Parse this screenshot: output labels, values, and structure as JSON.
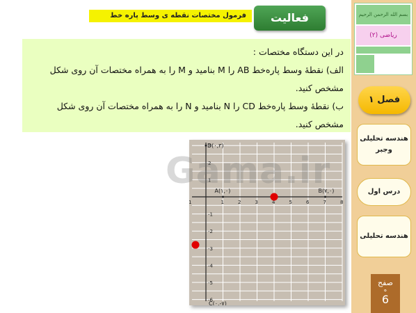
{
  "header": {
    "title": "فرمول مختصات نقطه ی وسط پاره خط",
    "activity_label": "فعالیت"
  },
  "problem": {
    "intro": "در این دستگاه مختصات :",
    "part_a": "الف) نقطهٔ وسط پاره‌خط AB را M بنامید و M را به همراه مختصات آن روی شکل مشخص کنید.",
    "part_b": "ب) نقطهٔ وسط پاره‌خط CD را N بنامید و N را به همراه مختصات آن روی شکل مشخص کنید."
  },
  "graph": {
    "x_ticks": [
      "-1",
      "1",
      "2",
      "3",
      "4",
      "5",
      "6",
      "7",
      "8"
    ],
    "y_ticks": [
      "4",
      "3",
      "2",
      "1",
      "-1",
      "-2",
      "-3",
      "-4",
      "-5",
      "-6",
      "-7",
      "-8"
    ],
    "points": [
      {
        "label": "D(۰,۳)"
      },
      {
        "label": "A(۱,۰)"
      },
      {
        "label": "B(۷,۰)"
      },
      {
        "label": "C(۰,-۷)"
      }
    ],
    "marker_color": "#e00000"
  },
  "watermark": "Gama.ir",
  "sidebar": {
    "thumb_top": "بسم الله الرحمن الرحیم",
    "thumb_subject": "ریاضی (۲)",
    "chapter": "فصل ۱",
    "topic": "هندسه تحلیلی وجبر",
    "lesson": "درس اول",
    "lesson_topic": "هندسه تحلیلی",
    "page_label": "صفح",
    "page_sub": "ه",
    "page_number": "6"
  }
}
